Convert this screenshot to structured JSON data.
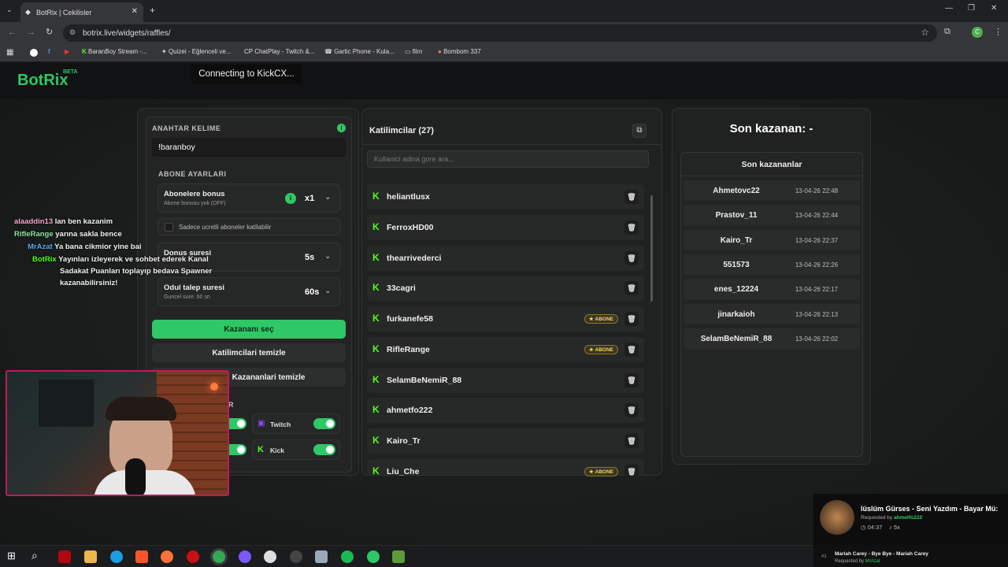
{
  "browser": {
    "tab_title": "BotRix | Cekilisler",
    "url": "botrix.live/widgets/raffles/",
    "bookmarks": [
      "BaranBoy Stream -...",
      "Quizei - Eğlenceli ve...",
      "ChatPlay - Twitch &...",
      "Gartic Phone - Kula...",
      "film",
      "Bombom 337"
    ]
  },
  "header": {
    "logo": "BotRix",
    "beta": "BETA",
    "overlay_status": "Connecting to KickCX..."
  },
  "settings": {
    "keyword_label": "ANAHTAR KELIME",
    "keyword_value": "!baranboy",
    "sub_settings_label": "ABONE AYARLARI",
    "sub_bonus_title": "Abonelere bonus",
    "sub_bonus_desc": "Abone bonusu yok (OFF)",
    "sub_bonus_value": "x1",
    "only_paid_subs": "Sadece ucretli aboneler katilabilir",
    "bonus_duration_title": "Donus suresi",
    "bonus_duration_value": "5s",
    "claim_title": "Odul talep suresi",
    "claim_desc": "Guncel sure: 60 sn",
    "claim_value": "60s",
    "pick_winner": "Kazananı seç",
    "clear_participants": "Katilimcilari temizle",
    "clear_winners": "Kazananlari temizle",
    "platforms_label": "R",
    "platform_twitch": "Twitch",
    "platform_kick": "Kick"
  },
  "participants": {
    "title": "Katilimcilar (27)",
    "search_placeholder": "Kullanici adina gore ara...",
    "badge_label": "ABONE",
    "items": [
      {
        "name": "heliantlusx",
        "sub": false
      },
      {
        "name": "FerroxHD00",
        "sub": false
      },
      {
        "name": "thearrivederci",
        "sub": false
      },
      {
        "name": "33cagri",
        "sub": false
      },
      {
        "name": "furkanefe58",
        "sub": true
      },
      {
        "name": "RifleRange",
        "sub": true
      },
      {
        "name": "SelamBeNemiR_88",
        "sub": false
      },
      {
        "name": "ahmetfo222",
        "sub": false
      },
      {
        "name": "Kairo_Tr",
        "sub": false
      },
      {
        "name": "Liu_Che",
        "sub": true
      }
    ]
  },
  "winners": {
    "title": "Son kazanan: -",
    "list_title": "Son kazananlar",
    "items": [
      {
        "name": "Ahmetovc22",
        "date": "13-04-26 22:48"
      },
      {
        "name": "Prastov_11",
        "date": "13-04-26 22:44"
      },
      {
        "name": "Kairo_Tr",
        "date": "13-04-26 22:37"
      },
      {
        "name": "551573",
        "date": "13-04-26 22:26"
      },
      {
        "name": "enes_12224",
        "date": "13-04-26 22:17"
      },
      {
        "name": "jinarkaioh",
        "date": "13-04-26 22:13"
      },
      {
        "name": "SelamBeNemiR_88",
        "date": "13-04-26 22:02"
      }
    ]
  },
  "chat": [
    {
      "user": "alaaddin13",
      "msg": "lan ben kazanim",
      "color": "#f7a6c8"
    },
    {
      "user": "RifleRange",
      "msg": "yarına sakla bence",
      "color": "#8fe3a3"
    },
    {
      "user": "MrAzat",
      "msg": "Ya bana cikmior yine bai",
      "color": "#5aa8f0"
    },
    {
      "user": "BotRix",
      "msg": "Yayınları izleyerek ve sohbet ederek Kanal",
      "color": "#53fc18"
    }
  ],
  "chat_cont": [
    "Sadakat Puanları toplayıp bedava Spawner",
    "kazanabilirsiniz!"
  ],
  "music": {
    "title": "lüslüm Gürses - Seni Yazdım - Bayar Mü:",
    "requested_prefix": "Requested by",
    "requested_by": "ahmetfo222",
    "duration": "04:37",
    "count": "5x",
    "next_index": "#1",
    "next_title": "Mariah Carey - Bye Bye - Mariah Carey",
    "next_requested": "MrAzat"
  },
  "colors": {
    "accent": "#2ec866",
    "kick": "#53fc18"
  }
}
